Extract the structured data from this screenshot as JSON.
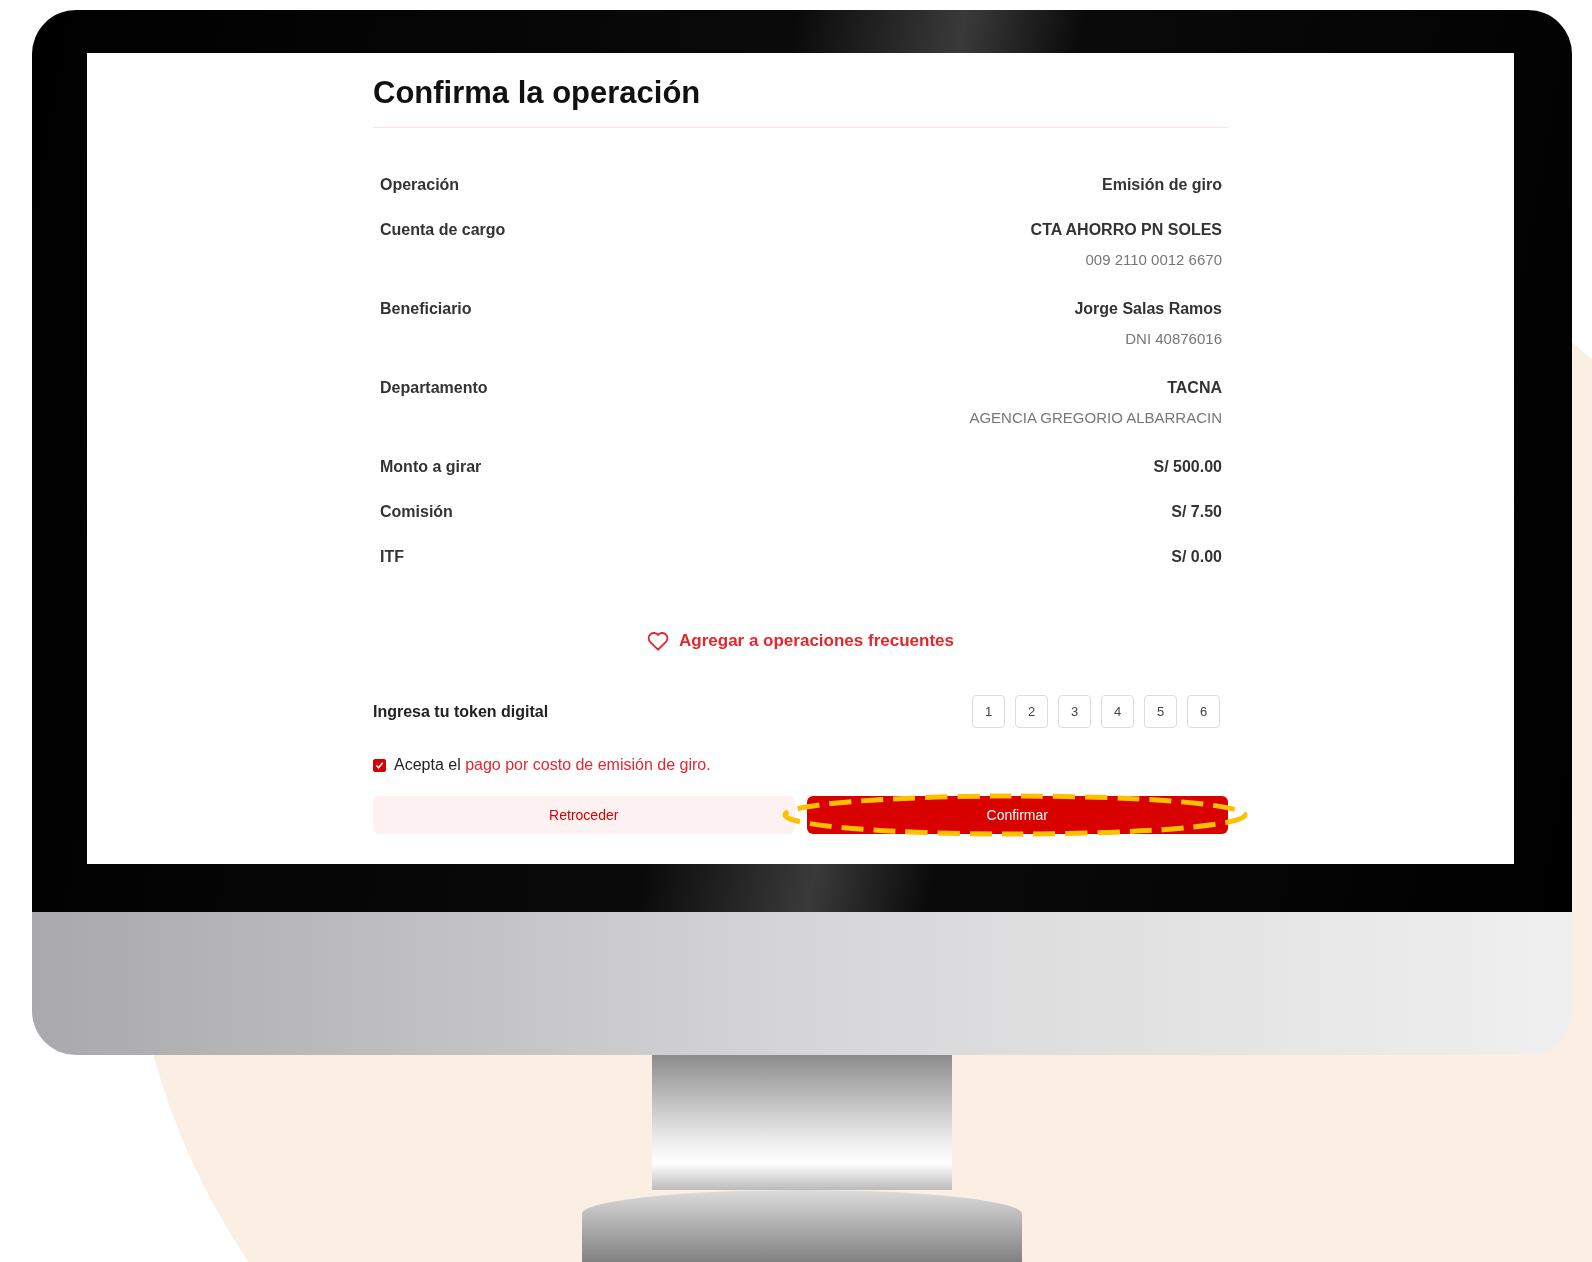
{
  "title": "Confirma la operación",
  "details": [
    {
      "label": "Operación",
      "value": "Emisión de giro"
    },
    {
      "label": "Cuenta de cargo",
      "value": "CTA AHORRO PN SOLES",
      "detail": "009 2110 0012 6670"
    },
    {
      "label": "Beneficiario",
      "value": "Jorge Salas Ramos",
      "detail": "DNI 40876016"
    },
    {
      "label": "Departamento",
      "value": "TACNA",
      "detail": "AGENCIA GREGORIO ALBARRACIN"
    },
    {
      "label": "Monto a girar",
      "value": "S/ 500.00"
    },
    {
      "label": "Comisión",
      "value": "S/ 7.50"
    },
    {
      "label": "ITF",
      "value": "S/ 0.00"
    }
  ],
  "favorite_link": "Agregar a operaciones frecuentes",
  "token": {
    "label": "Ingresa tu token digital",
    "digits": [
      "1",
      "2",
      "3",
      "4",
      "5",
      "6"
    ]
  },
  "terms": {
    "checked": true,
    "text": "Acepta el",
    "link": "pago por costo de emisión de giro."
  },
  "buttons": [
    {
      "label": "Retroceder",
      "kind": "secondary"
    },
    {
      "label": "Confirmar",
      "kind": "primary",
      "highlighted": true
    }
  ]
}
